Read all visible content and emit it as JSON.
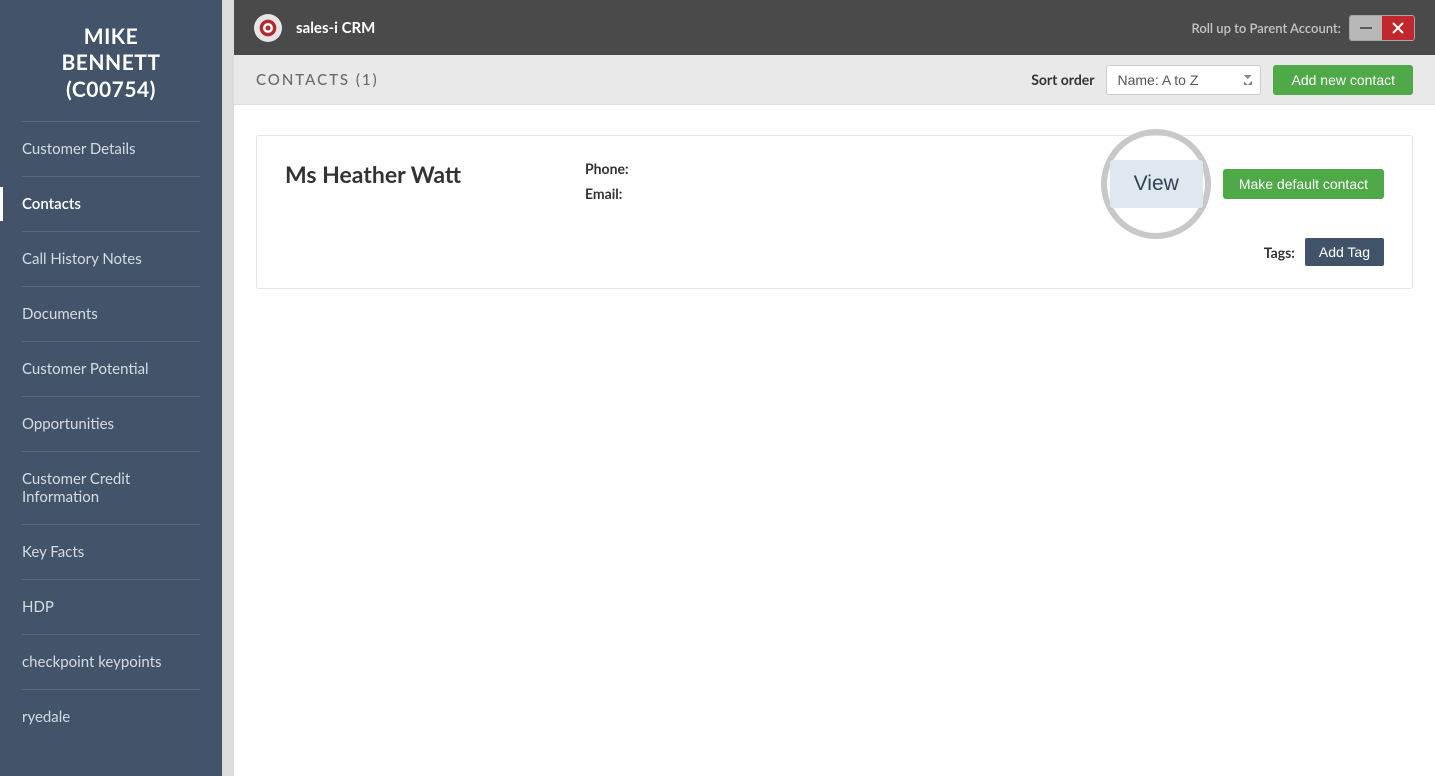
{
  "sidebar": {
    "title_line1": "MIKE",
    "title_line2": "BENNETT",
    "title_line3": "(C00754)",
    "items": [
      {
        "label": "Customer Details",
        "active": false
      },
      {
        "label": "Contacts",
        "active": true
      },
      {
        "label": "Call History Notes",
        "active": false
      },
      {
        "label": "Documents",
        "active": false
      },
      {
        "label": "Customer Potential",
        "active": false
      },
      {
        "label": "Opportunities",
        "active": false
      },
      {
        "label": "Customer Credit Information",
        "active": false
      },
      {
        "label": "Key Facts",
        "active": false
      },
      {
        "label": "HDP",
        "active": false
      },
      {
        "label": "checkpoint keypoints",
        "active": false
      },
      {
        "label": "ryedale",
        "active": false
      }
    ]
  },
  "topbar": {
    "app_name": "sales-i CRM",
    "parent_label": "Roll up to Parent Account:"
  },
  "subbar": {
    "title": "CONTACTS (1)",
    "sort_label": "Sort order",
    "sort_value": "Name: A to Z",
    "add_button": "Add new contact"
  },
  "contact": {
    "name": "Ms Heather Watt",
    "phone_label": "Phone:",
    "phone_value": "",
    "email_label": "Email:",
    "email_value": "",
    "view_label": "View",
    "default_label": "Make default contact",
    "tags_label": "Tags:",
    "add_tag_label": "Add Tag"
  }
}
